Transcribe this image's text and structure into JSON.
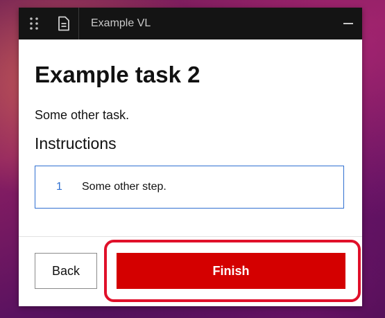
{
  "window": {
    "title": "Example VL",
    "menu_icon": "drag-grid-icon",
    "doc_icon": "document-icon",
    "minimize_icon": "minimize-icon"
  },
  "task": {
    "title": "Example task 2",
    "description": "Some other task.",
    "instructions_heading": "Instructions",
    "steps": [
      {
        "number": "1",
        "text": "Some other step."
      }
    ]
  },
  "footer": {
    "back_label": "Back",
    "finish_label": "Finish"
  },
  "colors": {
    "accent": "#d40000",
    "step_border": "#2f6fd1",
    "highlight": "#e0102a",
    "titlebar": "#141414"
  }
}
